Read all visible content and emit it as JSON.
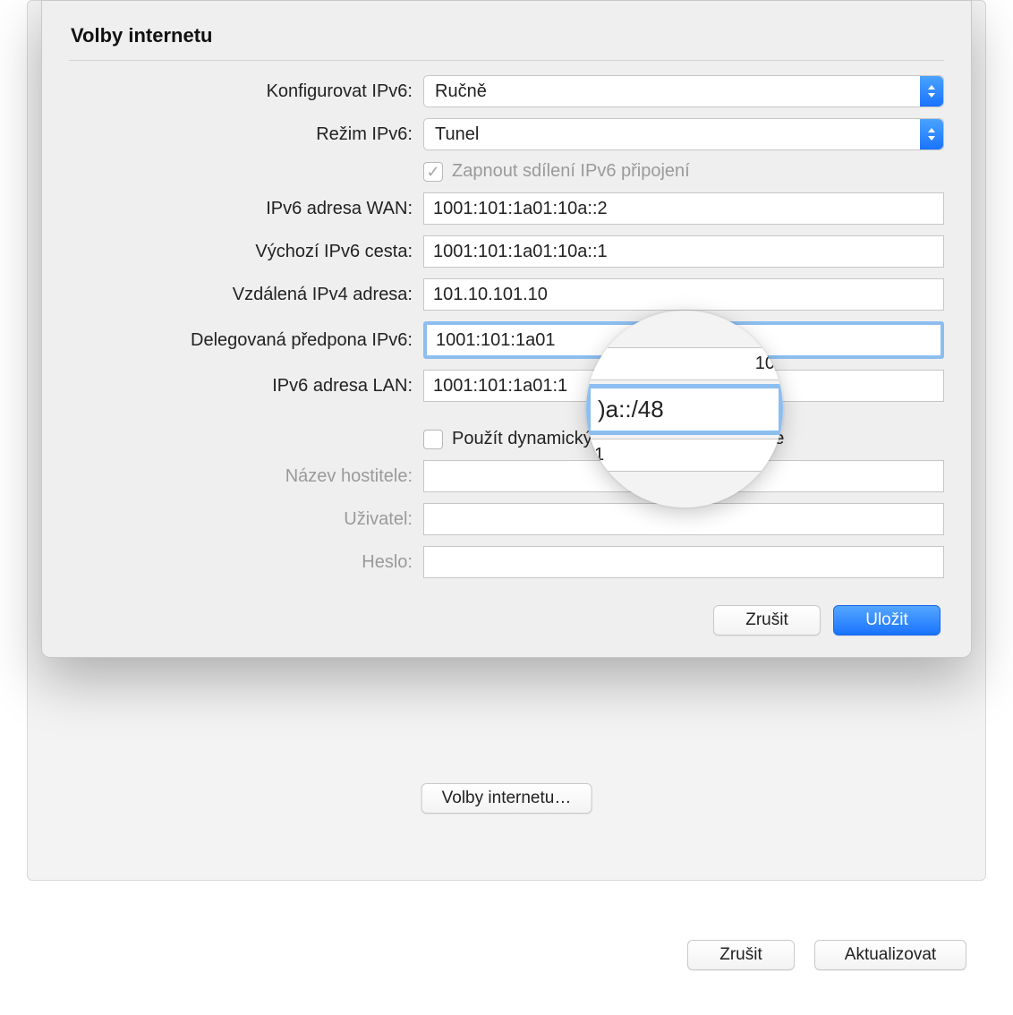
{
  "dialog": {
    "title": "Volby internetu",
    "configureIPv6": {
      "label": "Konfigurovat IPv6:",
      "value": "Ručně"
    },
    "modeIPv6": {
      "label": "Režim IPv6:",
      "value": "Tunel"
    },
    "enableSharing": {
      "label": "Zapnout sdílení IPv6 připojení",
      "checked": true
    },
    "wanAddress": {
      "label": "IPv6 adresa WAN:",
      "value": "1001:101:1a01:10a::2"
    },
    "defaultRoute": {
      "label": "Výchozí IPv6 cesta:",
      "value": "1001:101:1a01:10a::1"
    },
    "remoteIPv4": {
      "label": "Vzdálená IPv4 adresa:",
      "value": "101.10.101.10"
    },
    "delegatedPrefix": {
      "label": "Delegovaná předpona IPv6:",
      "value": "1001:101:1a01:10a::/48",
      "visibleLeft": "1001:101:1a01"
    },
    "lanAddress": {
      "label": "IPv6 adresa LAN:",
      "value": "1001:101:1a01:1"
    },
    "dynamicHost": {
      "label": "Použít dynamický globální název hostitele",
      "checked": false
    },
    "hostname": {
      "label": "Název hostitele:",
      "value": ""
    },
    "user": {
      "label": "Uživatel:",
      "value": ""
    },
    "password": {
      "label": "Heslo:",
      "value": ""
    },
    "cancel": "Zrušit",
    "save": "Uložit"
  },
  "magnifier": {
    "topFragment": "10",
    "focusFragment": ")a::/48",
    "bottomFragment": "1"
  },
  "belowButton": "Volby internetu…",
  "bottom": {
    "cancel": "Zrušit",
    "update": "Aktualizovat"
  }
}
